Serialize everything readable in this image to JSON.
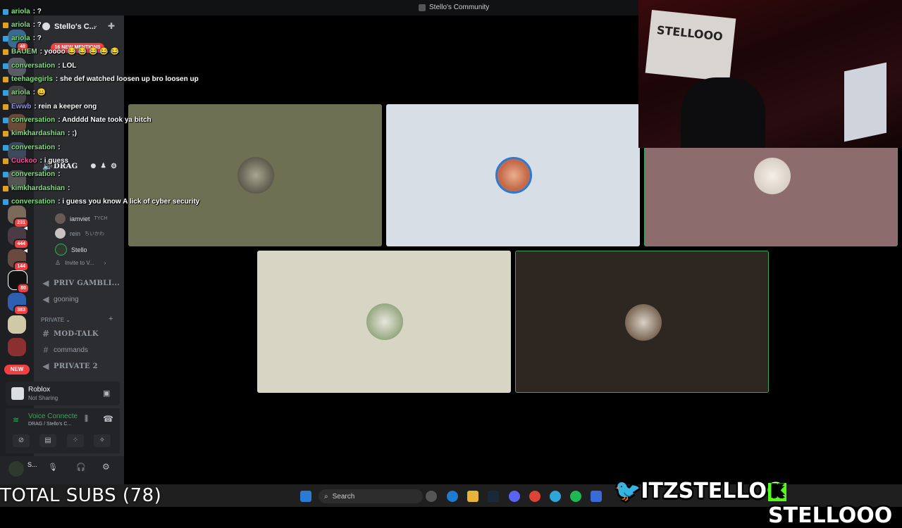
{
  "window": {
    "title": "Stello's Community"
  },
  "server": {
    "name": "Stello's C..."
  },
  "rail": {
    "badges": [
      "48",
      "231",
      "444",
      "144",
      "80",
      "383"
    ],
    "new_pill": "NEW",
    "mentions": "16 NEW MENTIONS"
  },
  "channels": {
    "items": [
      {
        "name": "DRAG",
        "type": "voice"
      },
      {
        "name": "PRIV GAMBLI...",
        "type": "voice"
      },
      {
        "name": "gooning",
        "type": "voice"
      },
      {
        "name": "MOD-TALK",
        "type": "text"
      },
      {
        "name": "commands",
        "type": "text"
      },
      {
        "name": "PRIVATE 2",
        "type": "voice"
      }
    ],
    "category_private": "PRIVATE",
    "voice_users": [
      {
        "name": "iamviet",
        "tag": "TYCH"
      },
      {
        "name": "rein",
        "tag": "ちいかわ"
      },
      {
        "name": "Stello",
        "tag": ""
      }
    ],
    "invite": "Invite to V..."
  },
  "activity": {
    "game": "Roblox",
    "status": "Not Sharing"
  },
  "voice": {
    "status": "Voice Connecte",
    "channel": "DRAG / Stello's C..."
  },
  "user": {
    "name": "S..."
  },
  "chat": [
    {
      "user": "ariola",
      "text": ": ?",
      "color": "#7ee37e"
    },
    {
      "user": "ariola",
      "text": ": ?",
      "color": "#7ee37e"
    },
    {
      "user": "ariola",
      "text": ": ?",
      "color": "#7ee37e"
    },
    {
      "user": "BAUEM",
      "text": ": yoooo 😂 😂 😂 😂 😂",
      "color": "#7ee37e"
    },
    {
      "user": "conversation",
      "text": ": LOL",
      "color": "#7ee37e"
    },
    {
      "user": "teehagegirls",
      "text": ": she def watched loosen up bro loosen up",
      "color": "#7ee37e"
    },
    {
      "user": "ariola",
      "text": ": 😀",
      "color": "#7ee37e"
    },
    {
      "user": "Ewwb",
      "text": ": rein a keeper ong",
      "color": "#8a8cff"
    },
    {
      "user": "conversation",
      "text": ": Andddd Nate took ya bitch",
      "color": "#7ee37e"
    },
    {
      "user": "kimkhardashian",
      "text": ": ;)",
      "color": "#7ee37e"
    },
    {
      "user": "conversation",
      "text": ":",
      "color": "#7ee37e"
    },
    {
      "user": "Cuckoo",
      "text": ": i guess",
      "color": "#ff4fa0"
    },
    {
      "user": "conversation",
      "text": ":",
      "color": "#7ee37e"
    },
    {
      "user": "kimkhardashian",
      "text": ":",
      "color": "#7ee37e"
    },
    {
      "user": "conversation",
      "text": ": i guess you know A lick of cyber security",
      "color": "#7ee37e"
    }
  ],
  "taskbar": {
    "search": "Search",
    "total_subs": "TOTAL SUBS (78)"
  },
  "overlay": {
    "twitter": "ITZSTELLOO",
    "kick": "STELLOOO"
  },
  "webcam": {
    "poster": "STELLOOO"
  },
  "colors": {
    "speaking": "#3ba55c",
    "tile_green": "#6e7053",
    "tile_blue": "#d8dee6",
    "tile_pink": "#8d6c6e",
    "tile_beige": "#d7d5c4",
    "tile_brown": "#2e2620"
  }
}
